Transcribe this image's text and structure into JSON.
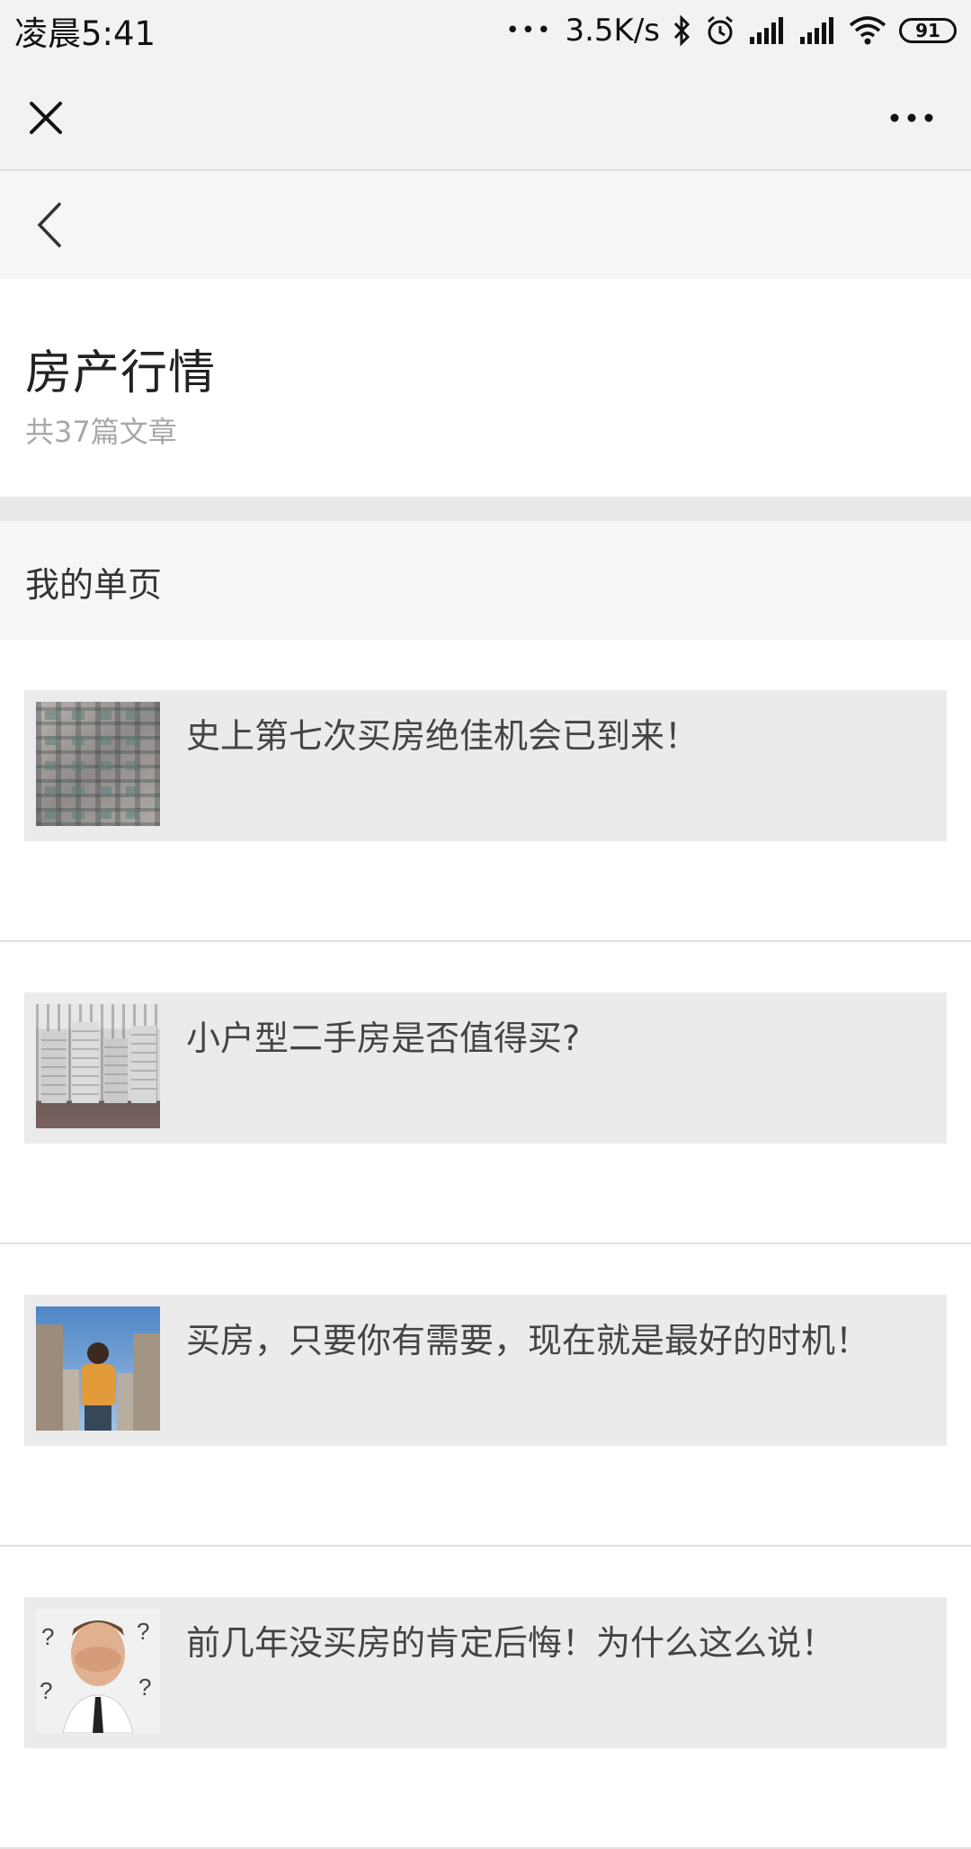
{
  "status_bar": {
    "time": "凌晨5:41",
    "dots": "•••",
    "net_speed": "3.5K/s",
    "battery": "91",
    "icons": [
      "bluetooth-icon",
      "alarm-icon",
      "signal-icon",
      "signal-icon",
      "wifi-icon",
      "battery-icon"
    ]
  },
  "nav": {
    "close_icon": "close-icon",
    "more_icon": "more-icon",
    "back_icon": "chevron-left-icon"
  },
  "header": {
    "title": "房产行情",
    "count": "共37篇文章"
  },
  "section": {
    "title": "我的单页"
  },
  "articles": [
    {
      "title": "史上第七次买房绝佳机会已到来！",
      "thumb": "apartment-facade-image"
    },
    {
      "title": "小户型二手房是否值得买?",
      "thumb": "high-rise-buildings-image"
    },
    {
      "title": "买房，只要你有需要，现在就是最好的时机！",
      "thumb": "man-looking-at-buildings-image"
    },
    {
      "title": "前几年没买房的肯定后悔！为什么这么说！",
      "thumb": "facepalm-man-image"
    }
  ],
  "colors": {
    "bar_bg": "#f2f2f2",
    "card_bg": "#ebebeb",
    "title_text": "#222222",
    "muted_text": "#a8a8a8"
  }
}
